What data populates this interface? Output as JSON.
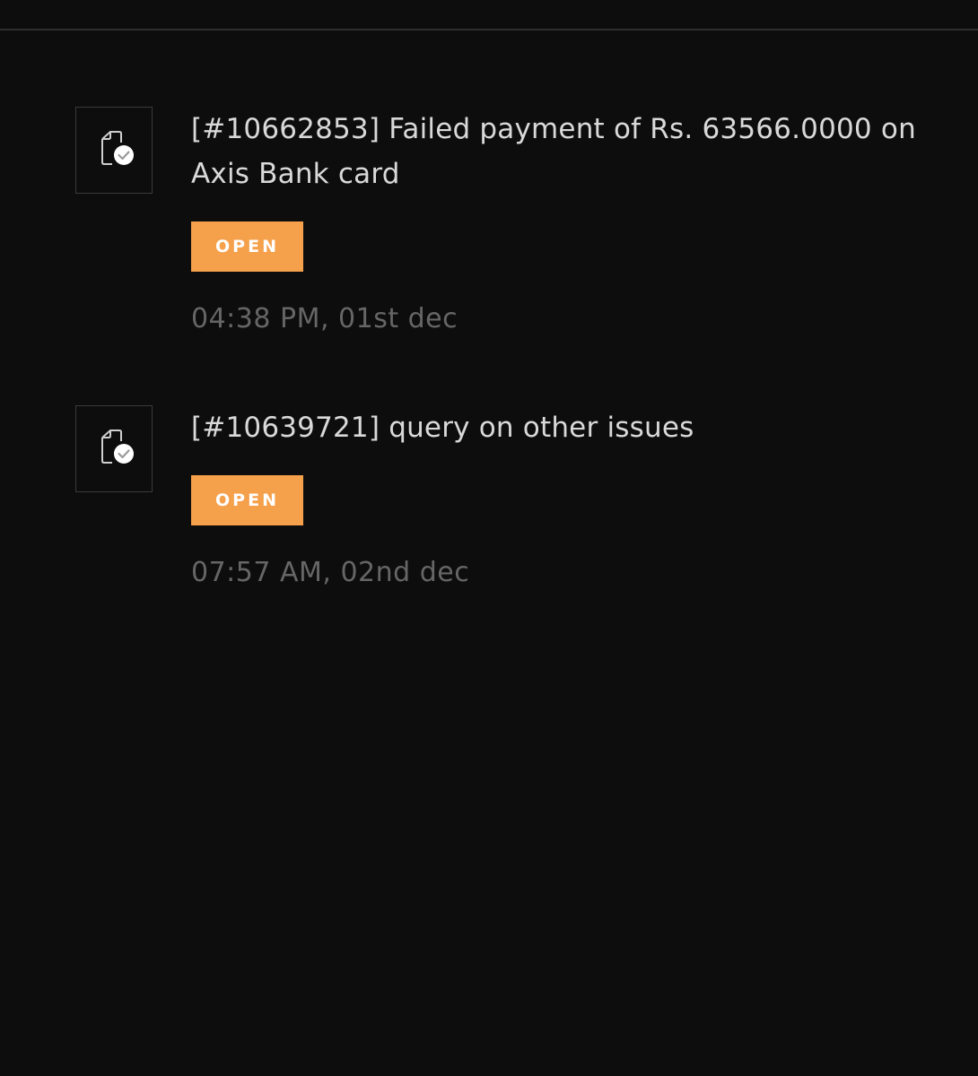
{
  "tickets": [
    {
      "title": "[#10662853] Failed payment of Rs. 63566.0000 on Axis Bank card",
      "status": "OPEN",
      "time": "04:38 PM, 01st dec",
      "icon": "document-check-icon"
    },
    {
      "title": "[#10639721] query on other issues",
      "status": "OPEN",
      "time": "07:57 AM, 02nd dec",
      "icon": "document-check-icon"
    }
  ],
  "colors": {
    "background": "#0d0d0d",
    "status_open": "#f5a04b",
    "title_text": "#d9d9d9",
    "time_text": "#666666"
  }
}
